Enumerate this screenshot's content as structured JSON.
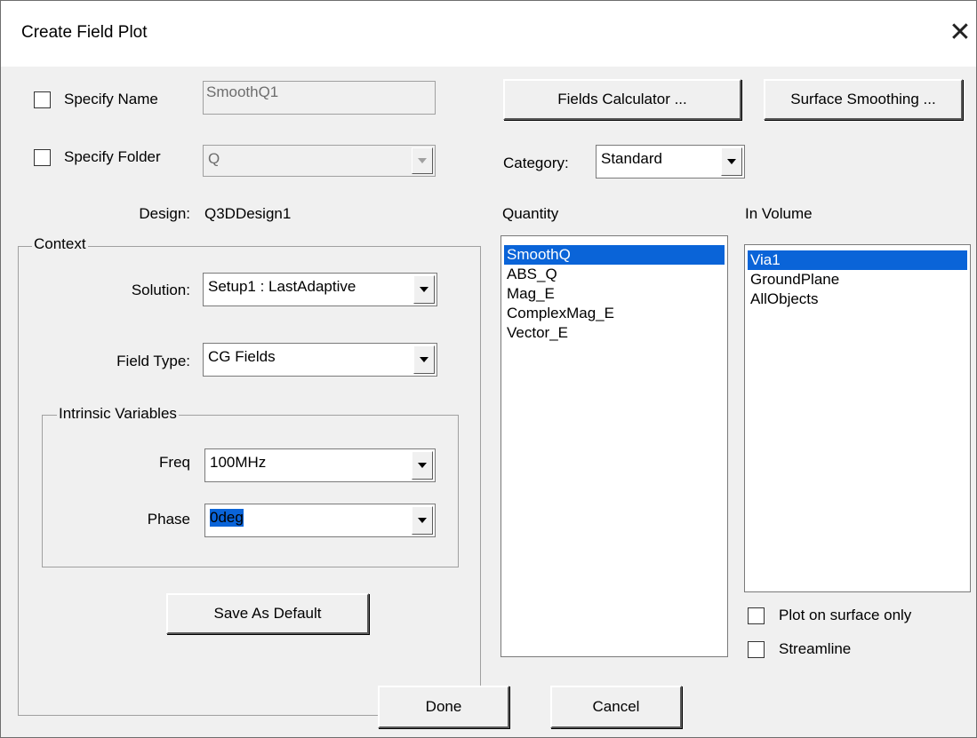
{
  "dialog": {
    "title": "Create Field Plot",
    "close_symbol": "✕"
  },
  "specify_name": {
    "label": "Specify Name",
    "checked": false,
    "value": "SmoothQ1"
  },
  "specify_folder": {
    "label": "Specify Folder",
    "checked": false,
    "value": "Q"
  },
  "design": {
    "label": "Design:",
    "value": "Q3DDesign1"
  },
  "context": {
    "legend": "Context",
    "solution_label": "Solution:",
    "solution_value": "Setup1 : LastAdaptive",
    "field_type_label": "Field Type:",
    "field_type_value": "CG Fields",
    "intrinsic": {
      "legend": "Intrinsic Variables",
      "freq_label": "Freq",
      "freq_value": "100MHz",
      "phase_label": "Phase",
      "phase_value": "0deg"
    },
    "save_default_label": "Save As Default"
  },
  "buttons": {
    "fields_calculator": "Fields Calculator ...",
    "surface_smoothing": "Surface Smoothing ...",
    "done": "Done",
    "cancel": "Cancel"
  },
  "category": {
    "label": "Category:",
    "value": "Standard"
  },
  "quantity": {
    "header": "Quantity",
    "items": [
      "SmoothQ",
      "ABS_Q",
      "Mag_E",
      "ComplexMag_E",
      "Vector_E"
    ],
    "selected_index": 0
  },
  "in_volume": {
    "header": "In Volume",
    "items": [
      "Via1",
      "GroundPlane",
      "AllObjects"
    ],
    "selected_index": 0
  },
  "options": {
    "plot_on_surface_only": {
      "label": "Plot on surface only",
      "checked": false
    },
    "streamline": {
      "label": "Streamline",
      "checked": false
    }
  },
  "colors": {
    "selection": "#0a64d8",
    "dialog_bg": "#f0f0f0"
  }
}
